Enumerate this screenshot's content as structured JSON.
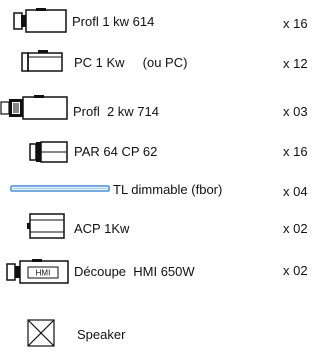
{
  "legend": {
    "items": [
      {
        "icon": "profile-spot-icon",
        "label": "Profl 1 kw 614",
        "qty": "x 16"
      },
      {
        "icon": "pc-fresnel-icon",
        "label": "PC 1 Kw     (ou PC)",
        "qty": "x 12"
      },
      {
        "icon": "profile-spot-large-icon",
        "label": "Profl  2 kw 714",
        "qty": "x 03"
      },
      {
        "icon": "par-can-icon",
        "label": "PAR 64 CP 62",
        "qty": "x 16"
      },
      {
        "icon": "fluorescent-tube-icon",
        "label": "TL dimmable (fbor)",
        "qty": "x 04"
      },
      {
        "icon": "acp-floodlight-icon",
        "label": "ACP 1Kw",
        "qty": "x 02"
      },
      {
        "icon": "hmi-followspot-icon",
        "label": "Découpe  HMI 650W",
        "qty": "x 02",
        "badge": "HMI"
      },
      {
        "icon": "speaker-icon",
        "label": "Speaker",
        "qty": ""
      }
    ]
  }
}
